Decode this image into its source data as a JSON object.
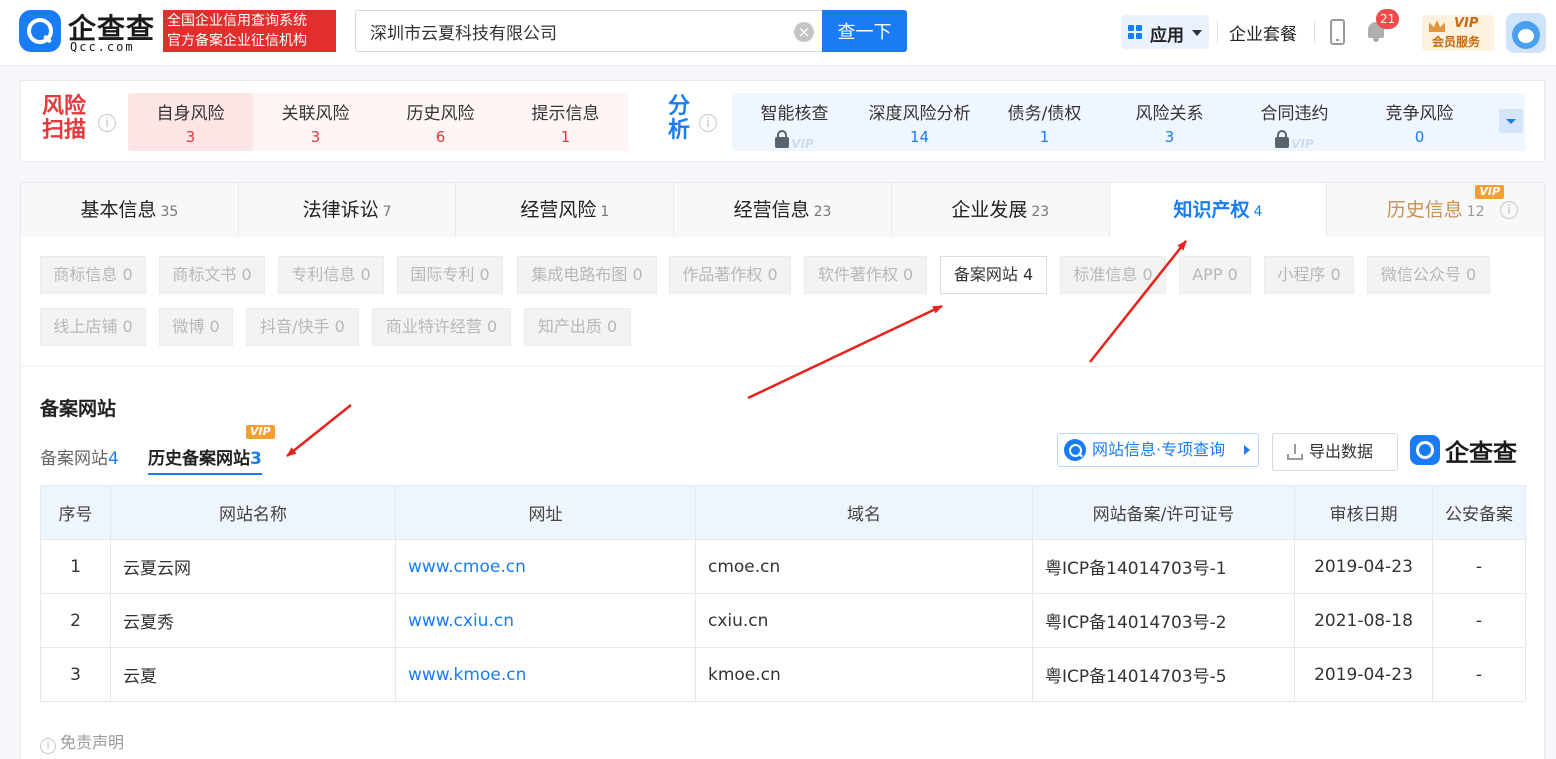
{
  "header": {
    "logo_name": "企查查",
    "logo_domain": "Qcc.com",
    "slogan_line1": "全国企业信用查询系统",
    "slogan_line2": "官方备案企业征信机构",
    "search_value": "深圳市云夏科技有限公司",
    "search_button": "查一下",
    "app_label": "应用",
    "package_link": "企业套餐",
    "notification_count": "21",
    "vip_label": "VIP",
    "vip_sub": "会员服务"
  },
  "risk_scan": {
    "title": "风险扫描",
    "items": [
      {
        "label": "自身风险",
        "value": "3"
      },
      {
        "label": "关联风险",
        "value": "3"
      },
      {
        "label": "历史风险",
        "value": "6"
      },
      {
        "label": "提示信息",
        "value": "1"
      }
    ]
  },
  "analysis": {
    "title": "分析",
    "items": [
      {
        "label": "智能核查",
        "value": "",
        "locked": true
      },
      {
        "label": "深度风险分析",
        "value": "14",
        "locked": false
      },
      {
        "label": "债务/债权",
        "value": "1",
        "locked": false
      },
      {
        "label": "风险关系",
        "value": "3",
        "locked": false
      },
      {
        "label": "合同违约",
        "value": "",
        "locked": true
      },
      {
        "label": "竞争风险",
        "value": "0",
        "locked": false
      }
    ],
    "vip_watermark": "VIP"
  },
  "main_tabs": [
    {
      "label": "基本信息",
      "count": "35"
    },
    {
      "label": "法律诉讼",
      "count": "7"
    },
    {
      "label": "经营风险",
      "count": "1"
    },
    {
      "label": "经营信息",
      "count": "23"
    },
    {
      "label": "企业发展",
      "count": "23"
    },
    {
      "label": "知识产权",
      "count": "4"
    },
    {
      "label": "历史信息",
      "count": "12",
      "vip_tag": "VIP"
    }
  ],
  "sub_tags_row1": [
    "商标信息 0",
    "商标文书 0",
    "专利信息 0",
    "国际专利 0",
    "集成电路布图 0",
    "作品著作权 0",
    "软件著作权 0",
    "备案网站 4",
    "标准信息 0",
    "APP 0",
    "小程序 0",
    "微信公众号 0"
  ],
  "sub_tags_row2": [
    "线上店铺 0",
    "微博 0",
    "抖音/快手 0",
    "商业特许经营 0",
    "知产出质 0"
  ],
  "section": {
    "title": "备案网站",
    "tab1_label": "备案网站",
    "tab1_count": "4",
    "tab2_label": "历史备案网站",
    "tab2_count": "3",
    "tab2_vip": "VIP",
    "query_button": "网站信息·专项查询",
    "export_button": "导出数据",
    "brand": "企查查"
  },
  "table": {
    "headers": [
      "序号",
      "网站名称",
      "网址",
      "域名",
      "网站备案/许可证号",
      "审核日期",
      "公安备案"
    ],
    "rows": [
      [
        "1",
        "云夏云网",
        "www.cmoe.cn",
        "cmoe.cn",
        "粤ICP备14014703号-1",
        "2019-04-23",
        "-"
      ],
      [
        "2",
        "云夏秀",
        "www.cxiu.cn",
        "cxiu.cn",
        "粤ICP备14014703号-2",
        "2021-08-18",
        "-"
      ],
      [
        "3",
        "云夏",
        "www.kmoe.cn",
        "kmoe.cn",
        "粤ICP备14014703号-5",
        "2019-04-23",
        "-"
      ]
    ]
  },
  "disclaimer": "免责声明",
  "colors": {
    "brand_blue": "#1a7cf5",
    "risk_red": "#e4393c",
    "vip_orange": "#f3a032"
  }
}
